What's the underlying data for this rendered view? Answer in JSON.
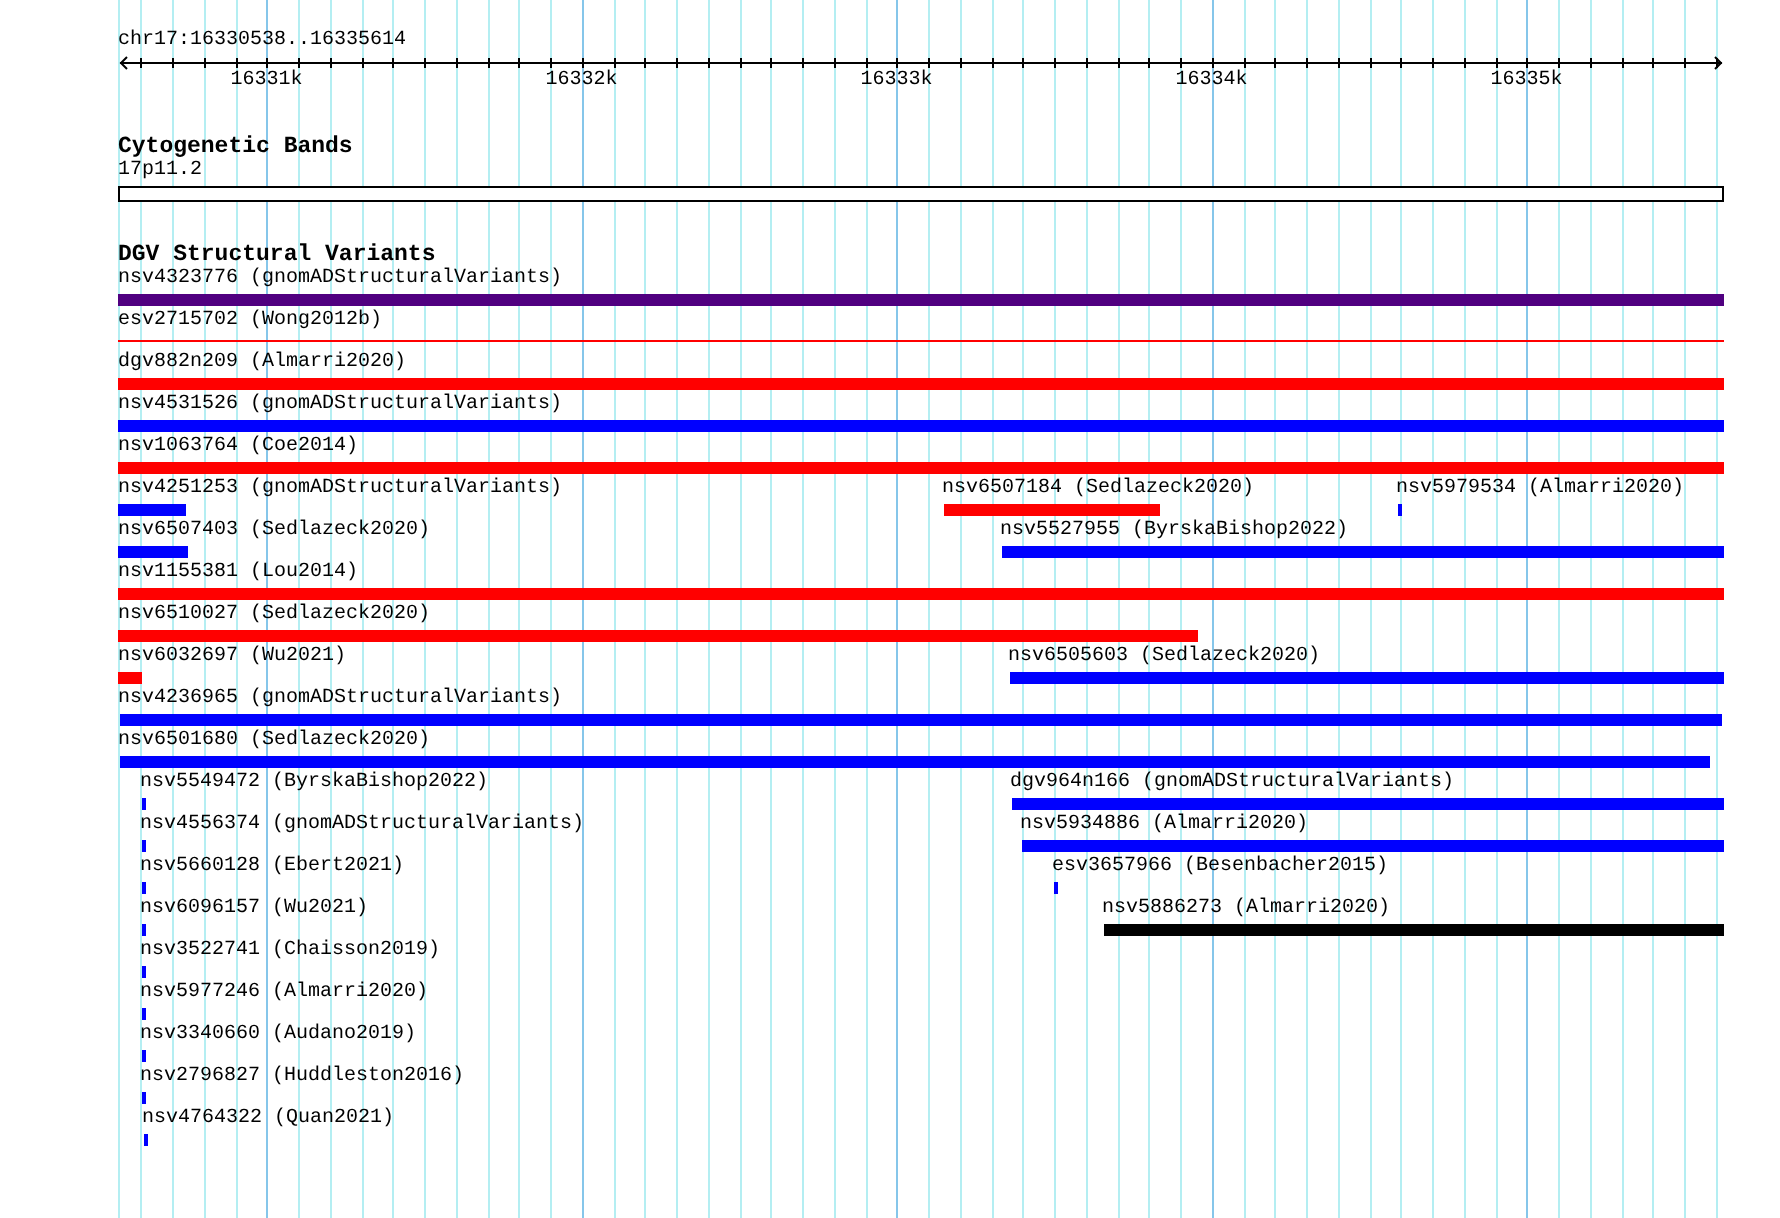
{
  "ruler": {
    "position": "chr17:16330538..16335614",
    "tick_labels": [
      "16331k",
      "16332k",
      "16333k",
      "16334k",
      "16335k"
    ]
  },
  "tracks": [
    {
      "kind": "cytoband",
      "title": "Cytogenetic Bands",
      "band": "17p11.2"
    },
    {
      "kind": "variants",
      "title": "DGV Structural Variants",
      "rows": [
        {
          "features": [
            {
              "label": "nsv4323776 (gnomADStructuralVariants)",
              "color": "#500080",
              "kind": "bar"
            }
          ]
        },
        {
          "features": [
            {
              "label": "esv2715702 (Wong2012b)",
              "color": "#ff0000",
              "kind": "line"
            }
          ]
        },
        {
          "features": [
            {
              "label": "dgv882n209 (Almarri2020)",
              "color": "#ff0000",
              "kind": "bar"
            }
          ]
        },
        {
          "features": [
            {
              "label": "nsv4531526 (gnomADStructuralVariants)",
              "color": "#0000ff",
              "kind": "bar"
            }
          ]
        },
        {
          "features": [
            {
              "label": "nsv1063764 (Coe2014)",
              "color": "#ff0000",
              "kind": "bar"
            }
          ]
        },
        {
          "features": [
            {
              "label": "nsv4251253 (gnomADStructuralVariants)",
              "color": "#0000ff",
              "kind": "bar"
            },
            {
              "label": "nsv6507184 (Sedlazeck2020)",
              "color": "#ff0000",
              "kind": "bar"
            },
            {
              "label": "nsv5979534 (Almarri2020)",
              "color": "#0000ff",
              "kind": "bar"
            }
          ]
        },
        {
          "features": [
            {
              "label": "nsv6507403 (Sedlazeck2020)",
              "color": "#0000ff",
              "kind": "bar"
            },
            {
              "label": "nsv5527955 (ByrskaBishop2022)",
              "color": "#0000ff",
              "kind": "bar"
            }
          ]
        },
        {
          "features": [
            {
              "label": "nsv1155381 (Lou2014)",
              "color": "#ff0000",
              "kind": "bar"
            }
          ]
        },
        {
          "features": [
            {
              "label": "nsv6510027 (Sedlazeck2020)",
              "color": "#ff0000",
              "kind": "bar"
            }
          ]
        },
        {
          "features": [
            {
              "label": "nsv6032697 (Wu2021)",
              "color": "#ff0000",
              "kind": "bar"
            },
            {
              "label": "nsv6505603 (Sedlazeck2020)",
              "color": "#0000ff",
              "kind": "bar"
            }
          ]
        },
        {
          "features": [
            {
              "label": "nsv4236965 (gnomADStructuralVariants)",
              "color": "#0000ff",
              "kind": "bar"
            }
          ]
        },
        {
          "features": [
            {
              "label": "nsv6501680 (Sedlazeck2020)",
              "color": "#0000ff",
              "kind": "bar"
            }
          ]
        },
        {
          "features": [
            {
              "label": "nsv5549472 (ByrskaBishop2022)",
              "color": "#0000ff",
              "kind": "bar"
            },
            {
              "label": "dgv964n166 (gnomADStructuralVariants)",
              "color": "#0000ff",
              "kind": "bar"
            }
          ]
        },
        {
          "features": [
            {
              "label": "nsv4556374 (gnomADStructuralVariants)",
              "color": "#0000ff",
              "kind": "bar"
            },
            {
              "label": "nsv5934886 (Almarri2020)",
              "color": "#0000ff",
              "kind": "bar"
            }
          ]
        },
        {
          "features": [
            {
              "label": "nsv5660128 (Ebert2021)",
              "color": "#0000ff",
              "kind": "bar"
            },
            {
              "label": "esv3657966 (Besenbacher2015)",
              "color": "#0000ff",
              "kind": "bar"
            }
          ]
        },
        {
          "features": [
            {
              "label": "nsv6096157 (Wu2021)",
              "color": "#0000ff",
              "kind": "bar"
            },
            {
              "label": "nsv5886273 (Almarri2020)",
              "color": "#000000",
              "kind": "bar"
            }
          ]
        },
        {
          "features": [
            {
              "label": "nsv3522741 (Chaisson2019)",
              "color": "#0000ff",
              "kind": "bar"
            }
          ]
        },
        {
          "features": [
            {
              "label": "nsv5977246 (Almarri2020)",
              "color": "#0000ff",
              "kind": "bar"
            }
          ]
        },
        {
          "features": [
            {
              "label": "nsv3340660 (Audano2019)",
              "color": "#0000ff",
              "kind": "bar"
            }
          ]
        },
        {
          "features": [
            {
              "label": "nsv2796827 (Huddleston2016)",
              "color": "#0000ff",
              "kind": "bar"
            }
          ]
        },
        {
          "features": [
            {
              "label": "nsv4764322 (Quan2021)",
              "color": "#0000ff",
              "kind": "bar"
            }
          ]
        }
      ]
    }
  ]
}
